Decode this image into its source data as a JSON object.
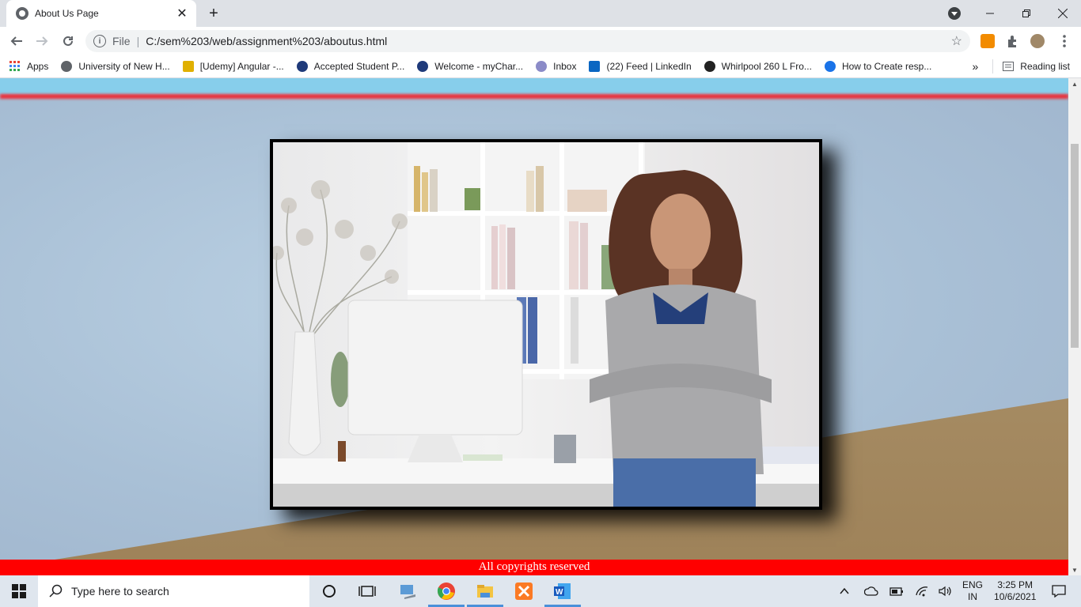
{
  "browser": {
    "tab_title": "About Us Page",
    "tab_close": "✕",
    "new_tab": "+",
    "url_scheme": "File",
    "url": "C:/sem%203/web/assignment%203/aboutus.html",
    "bookmarks": [
      {
        "label": "Apps",
        "icon": "apps-grid-icon",
        "color": "#4285f4"
      },
      {
        "label": "University of New H...",
        "icon": "globe-icon",
        "color": "#5f6368"
      },
      {
        "label": "[Udemy] Angular -...",
        "icon": "udemy-icon",
        "color": "#e0b000"
      },
      {
        "label": "Accepted Student P...",
        "icon": "university-seal-icon",
        "color": "#1f3a7a"
      },
      {
        "label": "Welcome - myChar...",
        "icon": "mycharlotte-icon",
        "color": "#1f3a7a"
      },
      {
        "label": "Inbox",
        "icon": "mail-seal-icon",
        "color": "#8b8bc8"
      },
      {
        "label": "(22) Feed | LinkedIn",
        "icon": "linkedin-icon",
        "color": "#0a66c2"
      },
      {
        "label": "Whirlpool 260 L Fro...",
        "icon": "amazon-icon",
        "color": "#222222"
      },
      {
        "label": "How to Create resp...",
        "icon": "help-icon",
        "color": "#1a73e8"
      }
    ],
    "bookmarks_overflow": "»",
    "reading_list": "Reading list"
  },
  "page": {
    "footer_text": "All copyrights reserved",
    "photo_alt": "Woman standing with arms crossed in an office"
  },
  "taskbar": {
    "search_placeholder": "Type here to search",
    "language_top": "ENG",
    "language_bottom": "IN",
    "time": "3:25 PM",
    "date": "10/6/2021"
  }
}
